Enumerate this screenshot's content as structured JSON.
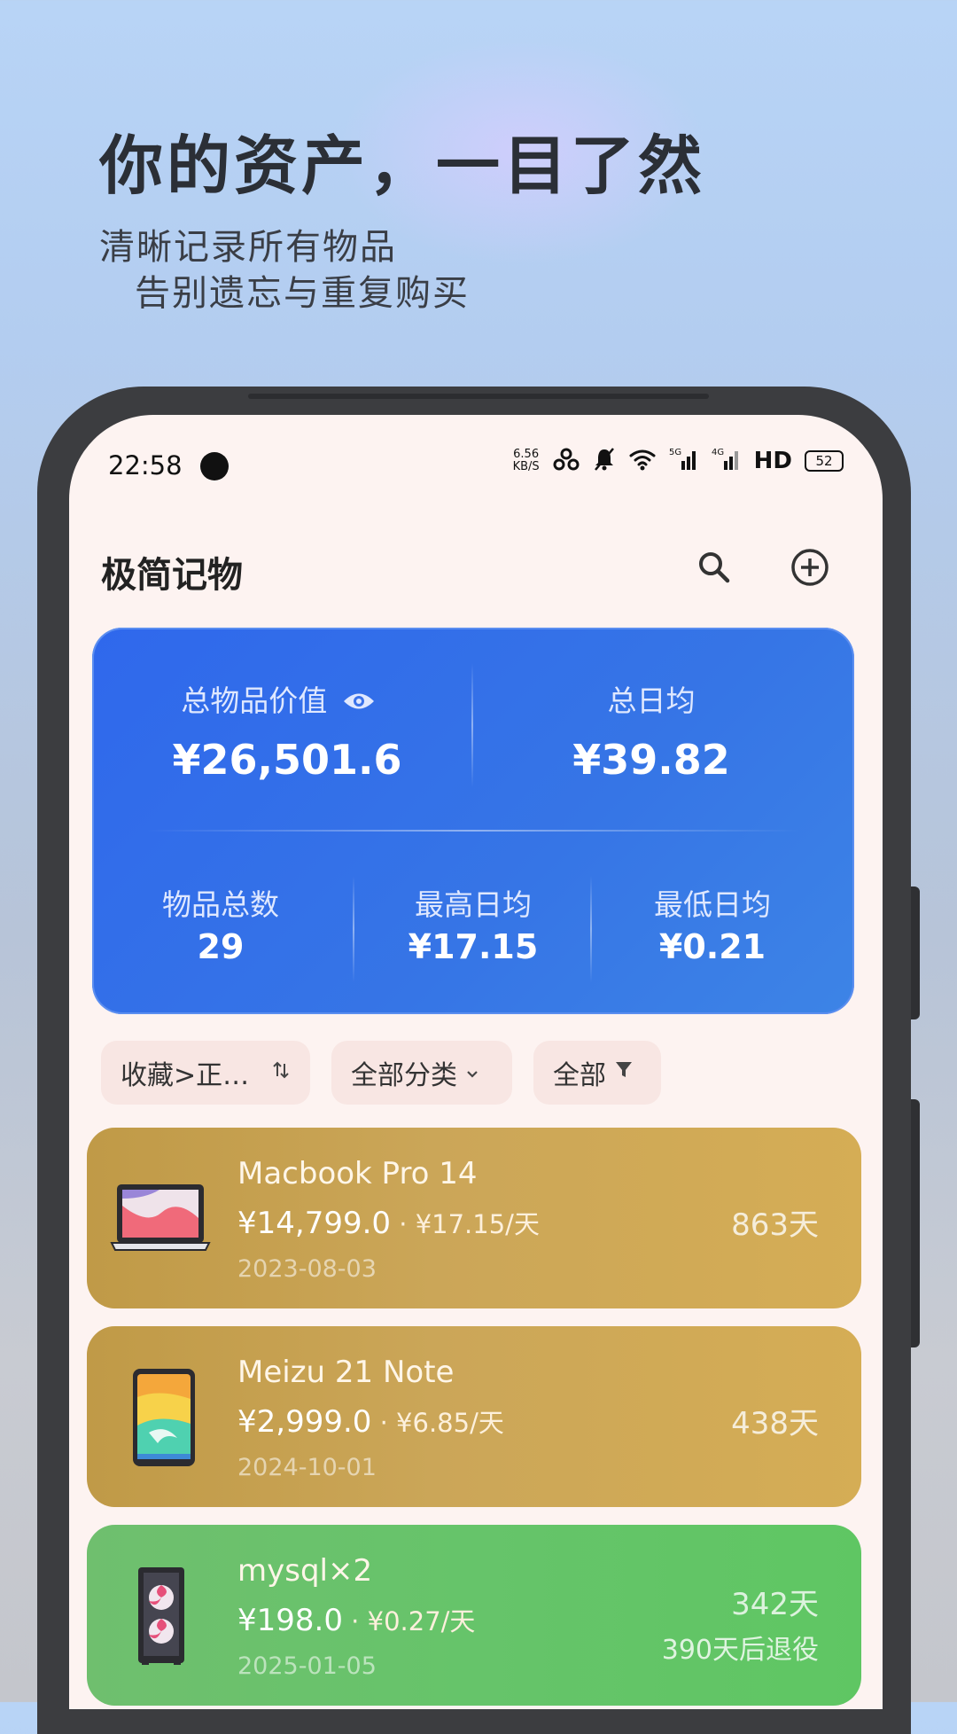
{
  "promo": {
    "headline": "你的资产，一目了然",
    "subline1": "清晰记录所有物品",
    "subline2": "告别遗忘与重复购买"
  },
  "status_bar": {
    "time": "22:58",
    "net_speed_value": "6.56",
    "net_speed_unit": "KB/S",
    "hd_label": "HD",
    "battery": "52",
    "signal_5g": "5G",
    "signal_4g": "4G"
  },
  "app": {
    "title": "极简记物"
  },
  "stats": {
    "total_value_label": "总物品价值",
    "total_value": "¥26,501.6",
    "total_daily_label": "总日均",
    "total_daily": "¥39.82",
    "count_label": "物品总数",
    "count": "29",
    "max_daily_label": "最高日均",
    "max_daily": "¥17.15",
    "min_daily_label": "最低日均",
    "min_daily": "¥0.21"
  },
  "filters": {
    "sort_label": "收藏>正…",
    "category_label": "全部分类",
    "status_label": "全部"
  },
  "items": [
    {
      "name": "Macbook Pro 14",
      "price": "¥14,799.0",
      "per_day": " · ¥17.15/天",
      "date": "2023-08-03",
      "days": "863天",
      "icon": "laptop-icon",
      "color": "#c9a352"
    },
    {
      "name": "Meizu 21 Note",
      "price": "¥2,999.0",
      "per_day": " · ¥6.85/天",
      "date": "2024-10-01",
      "days": "438天",
      "icon": "phone-icon",
      "color": "#c9a352"
    },
    {
      "name": "mysql×2",
      "price": "¥198.0",
      "per_day": " · ¥0.27/天",
      "date": "2025-01-05",
      "days": "342天",
      "retire": "390天后退役",
      "icon": "server-case-icon",
      "color": "#66c46a"
    }
  ]
}
